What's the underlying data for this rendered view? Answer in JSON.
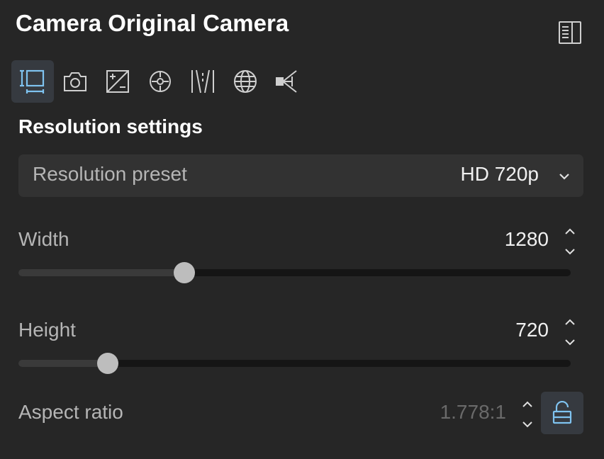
{
  "panel": {
    "title": "Camera Original Camera",
    "toggle_icon": "panel-toggle-icon"
  },
  "tabs": [
    {
      "icon": "resolution-icon",
      "active": true
    },
    {
      "icon": "camera-icon",
      "active": false
    },
    {
      "icon": "exposure-icon",
      "active": false
    },
    {
      "icon": "lens-focus-icon",
      "active": false
    },
    {
      "icon": "perspective-icon",
      "active": false
    },
    {
      "icon": "globe-icon",
      "active": false
    },
    {
      "icon": "camera-frustum-icon",
      "active": false
    }
  ],
  "section": {
    "title": "Resolution settings"
  },
  "preset": {
    "label": "Resolution preset",
    "value": "HD 720p"
  },
  "width": {
    "label": "Width",
    "value": "1280",
    "slider_fraction": 0.3
  },
  "height": {
    "label": "Height",
    "value": "720",
    "slider_fraction": 0.162
  },
  "aspect": {
    "label": "Aspect ratio",
    "value": "1.778:1",
    "locked": false
  },
  "colors": {
    "accent": "#7fc3f0",
    "background": "#262626"
  }
}
